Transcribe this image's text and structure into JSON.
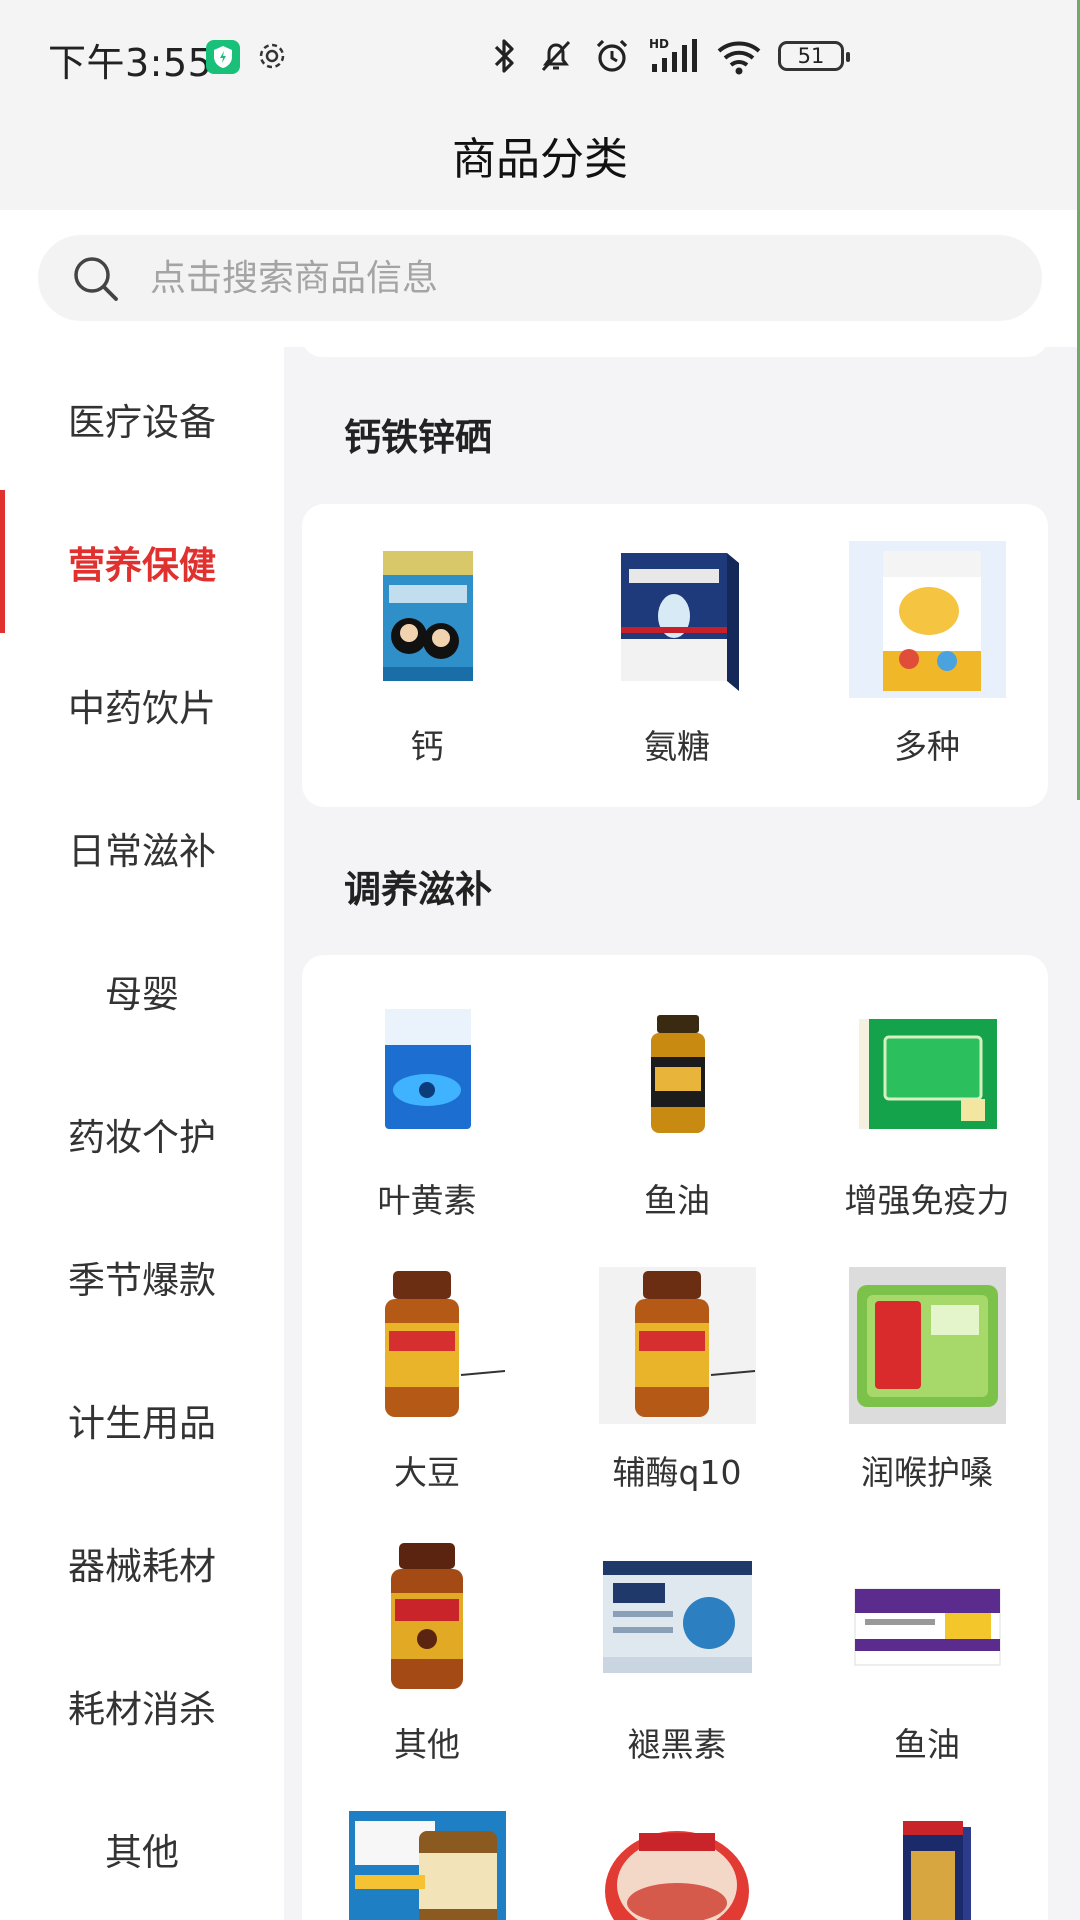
{
  "status_bar": {
    "time": "下午3:55",
    "battery": "51"
  },
  "header": {
    "title": "商品分类"
  },
  "search": {
    "placeholder": "点击搜索商品信息"
  },
  "sidebar": {
    "items": [
      {
        "label": "医疗设备"
      },
      {
        "label": "营养保健",
        "active": true
      },
      {
        "label": "中药饮片"
      },
      {
        "label": "日常滋补"
      },
      {
        "label": "母婴"
      },
      {
        "label": "药妆个护"
      },
      {
        "label": "季节爆款"
      },
      {
        "label": "计生用品"
      },
      {
        "label": "器械耗材"
      },
      {
        "label": "耗材消杀"
      },
      {
        "label": "其他"
      }
    ]
  },
  "sections": [
    {
      "title": "钙铁锌硒",
      "products": [
        {
          "label": "钙",
          "icon": "calcium-box-image"
        },
        {
          "label": "氨糖",
          "icon": "glucosamine-box-image"
        },
        {
          "label": "多种",
          "icon": "multivitamin-box-image"
        }
      ]
    },
    {
      "title": "调养滋补",
      "products": [
        {
          "label": "叶黄素",
          "icon": "lutein-box-image"
        },
        {
          "label": "鱼油",
          "icon": "fish-oil-bottle-image"
        },
        {
          "label": "增强免疫力",
          "icon": "immunity-box-image"
        },
        {
          "label": "大豆",
          "icon": "soy-bottle-image"
        },
        {
          "label": "辅酶q10",
          "icon": "coq10-bottle-image"
        },
        {
          "label": "润喉护嗓",
          "icon": "throat-tin-image"
        },
        {
          "label": "其他",
          "icon": "other-bottle-image"
        },
        {
          "label": "褪黑素",
          "icon": "melatonin-box-image"
        },
        {
          "label": "鱼油",
          "icon": "fish-oil-dha-box-image"
        }
      ]
    }
  ],
  "colors": {
    "accent": "#e1312f",
    "background": "#f4f3f5",
    "card": "#ffffff"
  }
}
